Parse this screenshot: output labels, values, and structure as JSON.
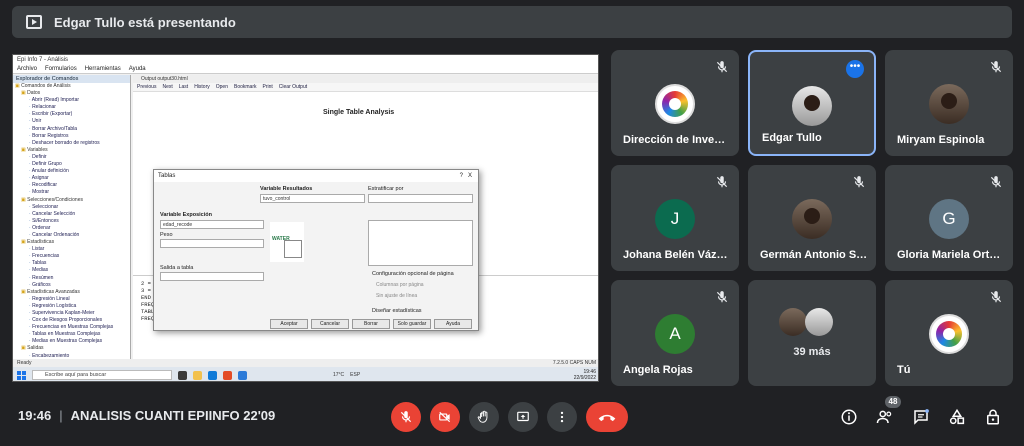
{
  "banner": {
    "text": "Edgar Tullo está presentando"
  },
  "screen": {
    "window_title": "Epi Info 7 - Análisis",
    "menu": [
      "Archivo",
      "Formularios",
      "Herramientas",
      "Ayuda"
    ],
    "tree_header": "Explorador de Comandos",
    "tree_items": [
      {
        "label": "Comandos de Análisis",
        "type": "folder"
      },
      {
        "label": "Datos",
        "type": "folder"
      },
      {
        "label": "Abrir (Read) Importar",
        "type": "leaf"
      },
      {
        "label": "Relacionar",
        "type": "leaf"
      },
      {
        "label": "Escribir (Exportar)",
        "type": "leaf"
      },
      {
        "label": "Unir",
        "type": "leaf"
      },
      {
        "label": "Borrar Archivo/Tabla",
        "type": "leaf"
      },
      {
        "label": "Borrar Registros",
        "type": "leaf"
      },
      {
        "label": "Deshacer borrado de registros",
        "type": "leaf"
      },
      {
        "label": "Variables",
        "type": "folder"
      },
      {
        "label": "Definir",
        "type": "leaf"
      },
      {
        "label": "Definir Grupo",
        "type": "leaf"
      },
      {
        "label": "Anular definición",
        "type": "leaf"
      },
      {
        "label": "Asignar",
        "type": "leaf"
      },
      {
        "label": "Recodificar",
        "type": "leaf"
      },
      {
        "label": "Mostrar",
        "type": "leaf"
      },
      {
        "label": "Selecciones/Condiciones",
        "type": "folder"
      },
      {
        "label": "Seleccionar",
        "type": "leaf"
      },
      {
        "label": "Cancelar Selección",
        "type": "leaf"
      },
      {
        "label": "Si/Entonces",
        "type": "leaf"
      },
      {
        "label": "Ordenar",
        "type": "leaf"
      },
      {
        "label": "Cancelar Ordenación",
        "type": "leaf"
      },
      {
        "label": "Estadísticas",
        "type": "folder"
      },
      {
        "label": "Listar",
        "type": "leaf"
      },
      {
        "label": "Frecuencias",
        "type": "leaf"
      },
      {
        "label": "Tablas",
        "type": "leaf"
      },
      {
        "label": "Medias",
        "type": "leaf"
      },
      {
        "label": "Resúmen",
        "type": "leaf"
      },
      {
        "label": "Gráficos",
        "type": "leaf"
      },
      {
        "label": "Estadísticas Avanzadas",
        "type": "folder"
      },
      {
        "label": "Regresión Lineal",
        "type": "leaf"
      },
      {
        "label": "Regresión Logística",
        "type": "leaf"
      },
      {
        "label": "Supervivencia Kaplan-Meier",
        "type": "leaf"
      },
      {
        "label": "Cox de Riesgos Proporcionales",
        "type": "leaf"
      },
      {
        "label": "Frecuencias en Muestras Complejas",
        "type": "leaf"
      },
      {
        "label": "Tablas en Muestras Complejas",
        "type": "leaf"
      },
      {
        "label": "Medias en Muestras Complejas",
        "type": "leaf"
      },
      {
        "label": "Salidas",
        "type": "folder"
      },
      {
        "label": "Encabezamiento",
        "type": "leaf"
      }
    ],
    "output_tab": "Output output30.html",
    "toolbar": [
      "Previous",
      "Next",
      "Last",
      "History",
      "Open",
      "Bookmark",
      "Print",
      "Clear Output"
    ],
    "output_heading": "Single Table Analysis",
    "console_lines": [
      "2 = *Bg *",
      "3 = *Br *",
      "END",
      "FREQ tuvo_control",
      "TABLES edad_recode tuvo_control",
      "FREQ tuvo_control"
    ],
    "status_left": "Ready",
    "status_right": "7.2.5.0   CAPS   NUM",
    "taskbar_search": "Escribe aquí para buscar",
    "taskbar_clock": "19:46",
    "taskbar_date": "22/9/2022",
    "taskbar_temp": "17°C",
    "taskbar_lang": "ESP"
  },
  "dialog": {
    "title": "Tablas",
    "help": "?",
    "close": "X",
    "var_result_label": "Variable Resultados",
    "var_result_value": "tuvo_control",
    "estratificar_label": "Estratificar por",
    "var_exposicion_label": "Variable Exposición",
    "var_exposicion_value": "edad_recode",
    "peso_label": "Peso",
    "salida_label": "Salida a tabla",
    "config_label": "Configuración opcional de página",
    "col_label": "Columnas por página",
    "no_line_label": "Sin ajuste de línea",
    "stats_label": "Diseñar estadísticas",
    "watermark": "WATER",
    "buttons": [
      "Aceptar",
      "Cancelar",
      "Borrar",
      "Solo guardar",
      "Ayuda"
    ]
  },
  "participants": [
    {
      "name": "Dirección de Inves…",
      "type": "logo"
    },
    {
      "name": "Edgar Tullo",
      "type": "photo",
      "active": true
    },
    {
      "name": "Miryam Espinola",
      "type": "photo"
    },
    {
      "name": "Johana Belén Vázq…",
      "type": "letter",
      "letter": "J",
      "color": "#0b6b4f"
    },
    {
      "name": "Germán Antonio S…",
      "type": "photo"
    },
    {
      "name": "Gloria Mariela Ort…",
      "type": "letter",
      "letter": "G",
      "color": "#5f7584"
    },
    {
      "name": "Angela Rojas",
      "type": "letter",
      "letter": "A",
      "color": "#2e7d32"
    },
    {
      "name": "",
      "type": "more",
      "more": "39 más"
    },
    {
      "name": "Tú",
      "type": "logo"
    }
  ],
  "bottom": {
    "time": "19:46",
    "separator": "|",
    "meeting_title": "ANALISIS CUANTI EPIINFO 22'09",
    "participant_count": "48"
  },
  "icons": {
    "mic_muted": "mic-off-icon",
    "camera_off": "camera-off-icon",
    "raise_hand": "hand-icon",
    "present": "present-icon",
    "more": "more-vert-icon",
    "end_call": "call-end-icon",
    "info": "info-icon",
    "people": "people-icon",
    "chat": "chat-icon",
    "activities": "activities-icon",
    "lock": "lock-icon"
  },
  "colors": {
    "background": "#202124",
    "tile": "#3c4043",
    "end_call": "#ea4335",
    "active_border": "#8ab4f8",
    "accent": "#1a73e8"
  }
}
